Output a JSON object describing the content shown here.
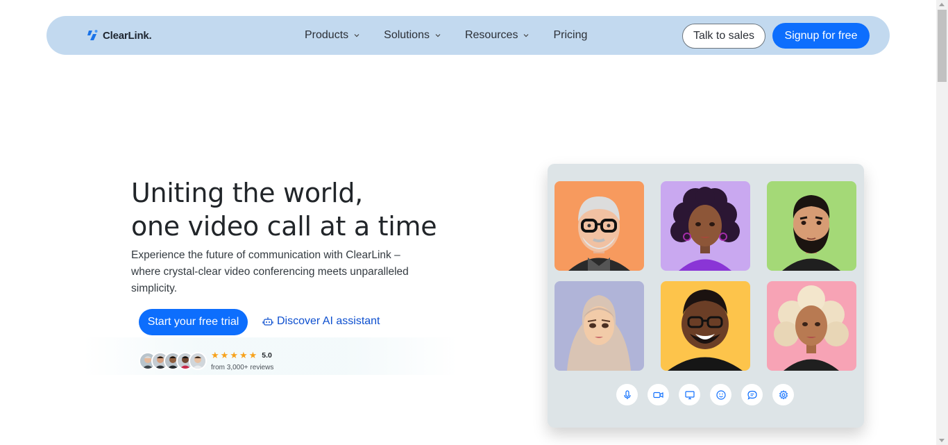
{
  "nav": {
    "brand": "ClearLink.",
    "links": [
      {
        "label": "Products",
        "has_dropdown": true
      },
      {
        "label": "Solutions",
        "has_dropdown": true
      },
      {
        "label": "Resources",
        "has_dropdown": true
      },
      {
        "label": "Pricing",
        "has_dropdown": false
      }
    ],
    "talk_to_sales": "Talk to sales",
    "signup": "Signup for free"
  },
  "hero": {
    "title_line1": "Uniting the world,",
    "title_line2": "one video call at a time",
    "subtitle": "Experience the future of communication with ClearLink – where crystal-clear video conferencing meets unparalleled simplicity.",
    "cta_primary": "Start your free trial",
    "cta_secondary": "Discover AI assistant",
    "rating_score": "5.0",
    "rating_count": "from 3,000+ reviews",
    "stars": 5
  },
  "call_panel": {
    "participants": [
      {
        "name": "participant-elderly-man",
        "bg": "#f79a5e"
      },
      {
        "name": "participant-curly-woman",
        "bg": "#c9a8f0"
      },
      {
        "name": "participant-bearded-man",
        "bg": "#a4d977"
      },
      {
        "name": "participant-hijab-woman",
        "bg": "#b0b4d8"
      },
      {
        "name": "participant-smiling-man",
        "bg": "#fdc44b"
      },
      {
        "name": "participant-blonde-woman",
        "bg": "#f7a3b5"
      }
    ],
    "controls": [
      "microphone-icon",
      "camera-icon",
      "screen-share-icon",
      "emoji-icon",
      "chat-icon",
      "settings-icon"
    ]
  },
  "colors": {
    "primary": "#0d6efd",
    "navbar_bg": "#c2d9ef",
    "panel_bg": "#dde4e7",
    "star": "#f7a21b"
  }
}
